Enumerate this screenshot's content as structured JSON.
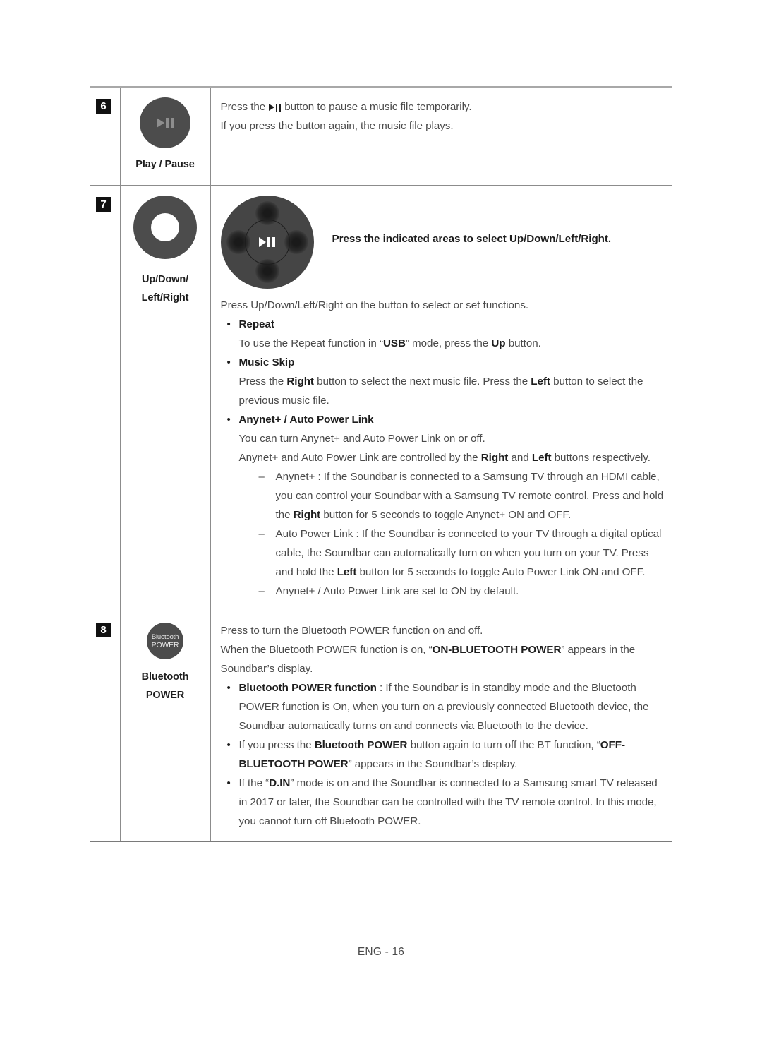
{
  "document": {
    "footer_label": "ENG - 16"
  },
  "table": {
    "rows": [
      {
        "number": "6",
        "icon": "play-pause-button",
        "caption_lines": [
          "Play / Pause"
        ],
        "lines": [
          "Press the ▶❘❘ button to pause a music file temporarily.",
          "If you press the button again, the music file plays."
        ],
        "line1_pre": "Press the ",
        "line1_post": " button to pause a music file temporarily.",
        "line2": "If you press the button again, the music file plays."
      },
      {
        "number": "7",
        "icon": "updown-leftright-ring",
        "caption_lines": [
          "Up/Down/",
          "Left/Right"
        ],
        "dpad_note": "Press the indicated areas to select Up/Down/Left/Right.",
        "intro": "Press Up/Down/Left/Right on the button to select or set functions.",
        "bullets": [
          {
            "title": "Repeat",
            "body": [
              {
                "segments": [
                  {
                    "t": "To use the Repeat function in “",
                    "b": false
                  },
                  {
                    "t": "USB",
                    "b": true
                  },
                  {
                    "t": "” mode, press the ",
                    "b": false
                  },
                  {
                    "t": "Up",
                    "b": true
                  },
                  {
                    "t": " button.",
                    "b": false
                  }
                ]
              }
            ]
          },
          {
            "title": "Music Skip",
            "body": [
              {
                "segments": [
                  {
                    "t": "Press the ",
                    "b": false
                  },
                  {
                    "t": "Right",
                    "b": true
                  },
                  {
                    "t": " button to select the next music file. Press the ",
                    "b": false
                  },
                  {
                    "t": "Left",
                    "b": true
                  },
                  {
                    "t": " button to select the previous music file.",
                    "b": false
                  }
                ]
              }
            ]
          },
          {
            "title": "Anynet+ / Auto Power Link",
            "body": [
              {
                "segments": [
                  {
                    "t": "You can turn Anynet+ and Auto Power Link on or off.",
                    "b": false
                  }
                ]
              },
              {
                "segments": [
                  {
                    "t": "Anynet+ and Auto Power Link are controlled by the ",
                    "b": false
                  },
                  {
                    "t": "Right",
                    "b": true
                  },
                  {
                    "t": " and ",
                    "b": false
                  },
                  {
                    "t": "Left",
                    "b": true
                  },
                  {
                    "t": " buttons respectively.",
                    "b": false
                  }
                ]
              }
            ],
            "dashes": [
              {
                "segments": [
                  {
                    "t": "Anynet+ : If the Soundbar is connected to a Samsung TV through an HDMI cable, you can control your Soundbar with a Samsung TV remote control. Press and hold the ",
                    "b": false
                  },
                  {
                    "t": "Right",
                    "b": true
                  },
                  {
                    "t": " button for 5 seconds to toggle Anynet+ ON and OFF.",
                    "b": false
                  }
                ]
              },
              {
                "segments": [
                  {
                    "t": "Auto Power Link : If the Soundbar is connected to your TV through a digital optical cable, the Soundbar can automatically turn on when you turn on your TV. Press and hold the ",
                    "b": false
                  },
                  {
                    "t": "Left",
                    "b": true
                  },
                  {
                    "t": " button for 5 seconds to toggle Auto Power Link ON and OFF.",
                    "b": false
                  }
                ]
              },
              {
                "segments": [
                  {
                    "t": "Anynet+ / Auto Power Link are set to ON by default.",
                    "b": false
                  }
                ]
              }
            ]
          }
        ]
      },
      {
        "number": "8",
        "icon": "bluetooth-power-button",
        "icon_label_line1": "Bluetooth",
        "icon_label_line2": "POWER",
        "caption_lines": [
          "Bluetooth",
          "POWER"
        ],
        "intro_paras": [
          {
            "segments": [
              {
                "t": "Press to turn the Bluetooth POWER function on and off.",
                "b": false
              }
            ]
          },
          {
            "segments": [
              {
                "t": "When the Bluetooth POWER function is on, “",
                "b": false
              },
              {
                "t": "ON-BLUETOOTH POWER",
                "b": true
              },
              {
                "t": "” appears in the Soundbar’s display.",
                "b": false
              }
            ]
          }
        ],
        "bullets": [
          {
            "segments": [
              {
                "t": "Bluetooth POWER function",
                "b": true
              },
              {
                "t": " : If the Soundbar is in standby mode and the Bluetooth POWER function is On, when you turn on a previously connected Bluetooth device, the Soundbar automatically turns on and connects via Bluetooth to the device.",
                "b": false
              }
            ]
          },
          {
            "segments": [
              {
                "t": "If you press the ",
                "b": false
              },
              {
                "t": "Bluetooth POWER",
                "b": true
              },
              {
                "t": " button again to turn off the BT function, “",
                "b": false
              },
              {
                "t": "OFF-BLUETOOTH POWER",
                "b": true
              },
              {
                "t": "” appears in the Soundbar’s display.",
                "b": false
              }
            ]
          },
          {
            "segments": [
              {
                "t": "If the “",
                "b": false
              },
              {
                "t": "D.IN",
                "b": true
              },
              {
                "t": "” mode is on and the Soundbar is connected to a Samsung smart TV released in 2017 or later, the Soundbar can be controlled with the TV remote control. In this mode, you cannot turn off Bluetooth POWER.",
                "b": false
              }
            ]
          }
        ]
      }
    ]
  }
}
